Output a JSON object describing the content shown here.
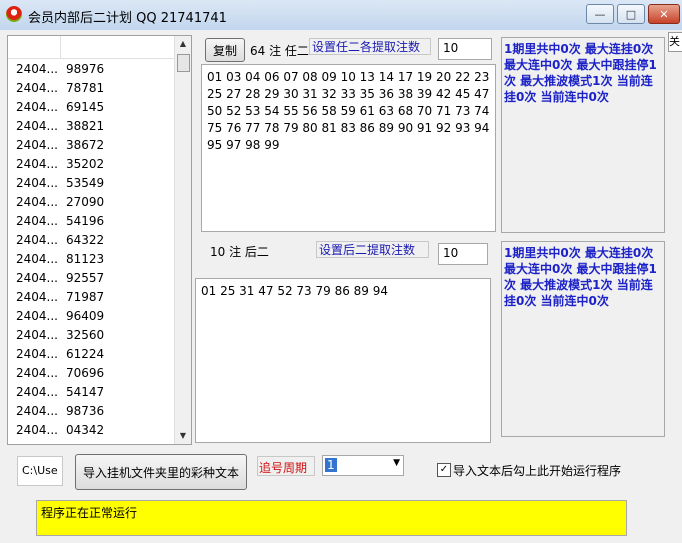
{
  "window": {
    "title": "会员内部后二计划 QQ 21741741",
    "minimize_glyph": "—",
    "maximize_glyph": "□",
    "close_glyph": "✕",
    "side_close_text": "关"
  },
  "history": {
    "rows": [
      {
        "period": "2404...",
        "number": "98976"
      },
      {
        "period": "2404...",
        "number": "78781"
      },
      {
        "period": "2404...",
        "number": "69145"
      },
      {
        "period": "2404...",
        "number": "38821"
      },
      {
        "period": "2404...",
        "number": "38672"
      },
      {
        "period": "2404...",
        "number": "35202"
      },
      {
        "period": "2404...",
        "number": "53549"
      },
      {
        "period": "2404...",
        "number": "27090"
      },
      {
        "period": "2404...",
        "number": "54196"
      },
      {
        "period": "2404...",
        "number": "64322"
      },
      {
        "period": "2404...",
        "number": "81123"
      },
      {
        "period": "2404...",
        "number": "92557"
      },
      {
        "period": "2404...",
        "number": "71987"
      },
      {
        "period": "2404...",
        "number": "96409"
      },
      {
        "period": "2404...",
        "number": "32560"
      },
      {
        "period": "2404...",
        "number": "61224"
      },
      {
        "period": "2404...",
        "number": "70696"
      },
      {
        "period": "2404...",
        "number": "54147"
      },
      {
        "period": "2404...",
        "number": "98736"
      },
      {
        "period": "2404...",
        "number": "04342"
      }
    ],
    "scroll_up_glyph": "▲",
    "scroll_down_glyph": "▼"
  },
  "section1": {
    "copy_label": "复制",
    "count_label": "64 注 任二",
    "setting_label": "设置任二各提取注数",
    "setting_value": "10",
    "numbers": "01 03 04 06 07 08 09 10 13 14 17 19 20 22 23 25 27 28 29 30 31 32 33 35 36 38 39 42 45 47 50 52 53 54 55 56 58 59 61 63 68 70 71 73 74 75 76 77 78 79 80 81 83 86 89 90 91 92 93 94 95 97 98 99",
    "stats": "1期里共中0次 最大连挂0次 最大连中0次 最大中跟挂停1次 最大推波模式1次 当前连挂0次 当前连中0次"
  },
  "section2": {
    "count_label": "10 注 后二",
    "setting_label": "设置后二提取注数",
    "setting_value": "10",
    "numbers": "01 25 31 47 52 73 79 86 89 94",
    "stats": "1期里共中0次 最大连挂0次 最大连中0次 最大中跟挂停1次 最大推波模式1次 当前连挂0次 当前连中0次"
  },
  "bottom": {
    "path_value": "C:\\Use",
    "import_button": "导入挂机文件夹里的彩种文本",
    "cycle_label": "追号周期",
    "cycle_value": "1",
    "dropdown_glyph": "▼",
    "check_mark": "✓",
    "auto_run_label": "导入文本后勾上此开始运行程序",
    "status_text": "程序正在正常运行"
  }
}
